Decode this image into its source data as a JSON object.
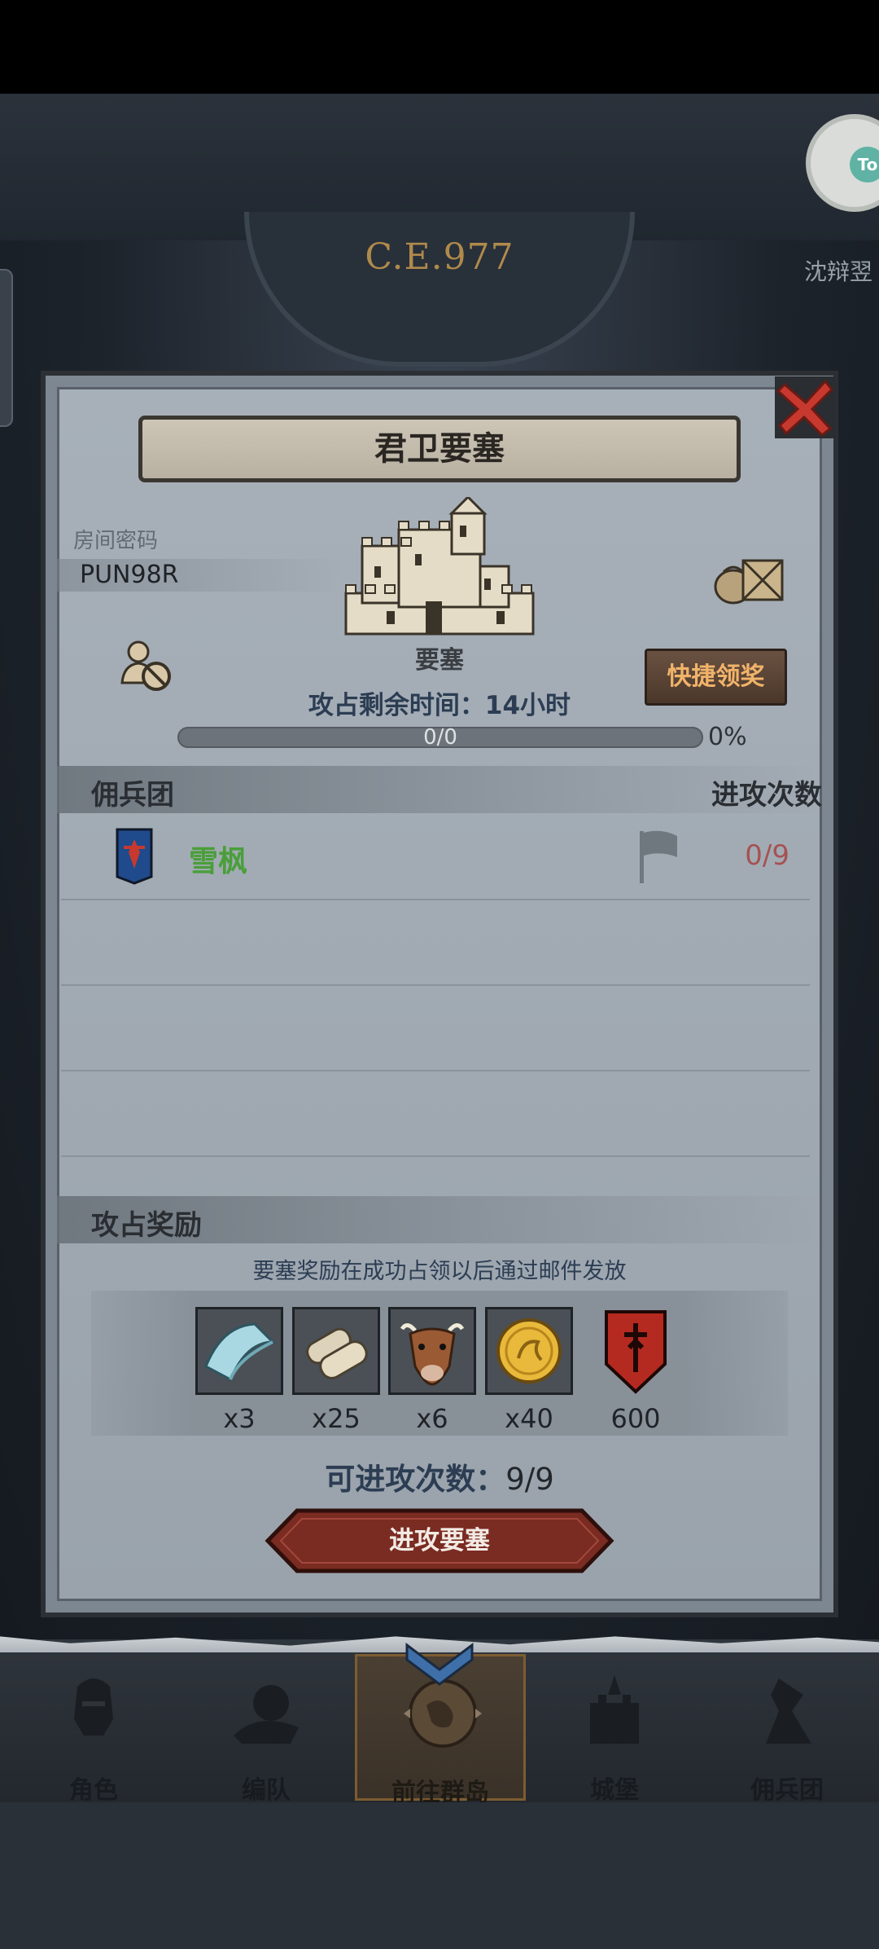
{
  "header": {
    "year": "C.E.977",
    "side_badge": "沈辩翌",
    "float_badge": "To"
  },
  "dialog": {
    "title": "君卫要塞",
    "room_label": "房间密码",
    "room_code": "PUN98R",
    "fort_label": "要塞",
    "quick_claim": "快捷领奖",
    "remaining_time": "攻占剩余时间：14小时",
    "progress": {
      "count": "0/0",
      "percent": "0%",
      "fraction": 0
    },
    "mercenary_header": {
      "left": "佣兵团",
      "right": "进攻次数"
    },
    "mercenaries": [
      {
        "name": "雪枫",
        "attacks": "0/9",
        "banner_color": "#1f4a8c"
      }
    ],
    "rewards_header": "攻占奖励",
    "reward_note": "要塞奖励在成功占领以后通过邮件发放",
    "rewards": [
      {
        "icon": "cloth-icon",
        "qty": "x3"
      },
      {
        "icon": "scroll-icon",
        "qty": "x25"
      },
      {
        "icon": "ox-icon",
        "qty": "x6"
      },
      {
        "icon": "gold-coin-icon",
        "qty": "x40"
      },
      {
        "icon": "honor-shield-icon",
        "qty": "600"
      }
    ],
    "attempts_label": "可进攻次数：",
    "attempts_value": "9/9",
    "attack_button": "进攻要塞"
  },
  "nav": {
    "items": [
      "角色",
      "编队",
      "前往群岛",
      "城堡",
      "佣兵团"
    ],
    "active_index": 2
  },
  "colors": {
    "accent_gold": "#f1b36a",
    "merc_name": "#4a9e3a",
    "attack_red": "#7a2b22"
  }
}
